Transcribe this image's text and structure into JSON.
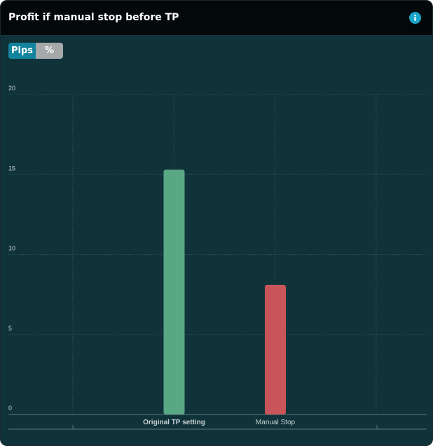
{
  "header": {
    "title": "Profit if manual stop before TP"
  },
  "toggle": {
    "pips_label": "Pips",
    "percent_label": "%",
    "selected": "Pips"
  },
  "colors": {
    "background": "#10333a",
    "header": "#03080a",
    "accent": "#13849d",
    "bar_green": "#5aa784",
    "bar_red": "#c85559"
  },
  "chart_data": {
    "type": "bar",
    "categories": [
      "Original TP setting",
      "Manual Stop"
    ],
    "values": [
      15.3,
      8.1
    ],
    "bar_colors": [
      "#5aa784",
      "#c85559"
    ],
    "title": "",
    "xlabel": "",
    "ylabel": "",
    "ylim": [
      0,
      20
    ],
    "yticks": [
      0,
      5,
      10,
      15,
      20
    ],
    "grid": true,
    "legend": "none"
  }
}
